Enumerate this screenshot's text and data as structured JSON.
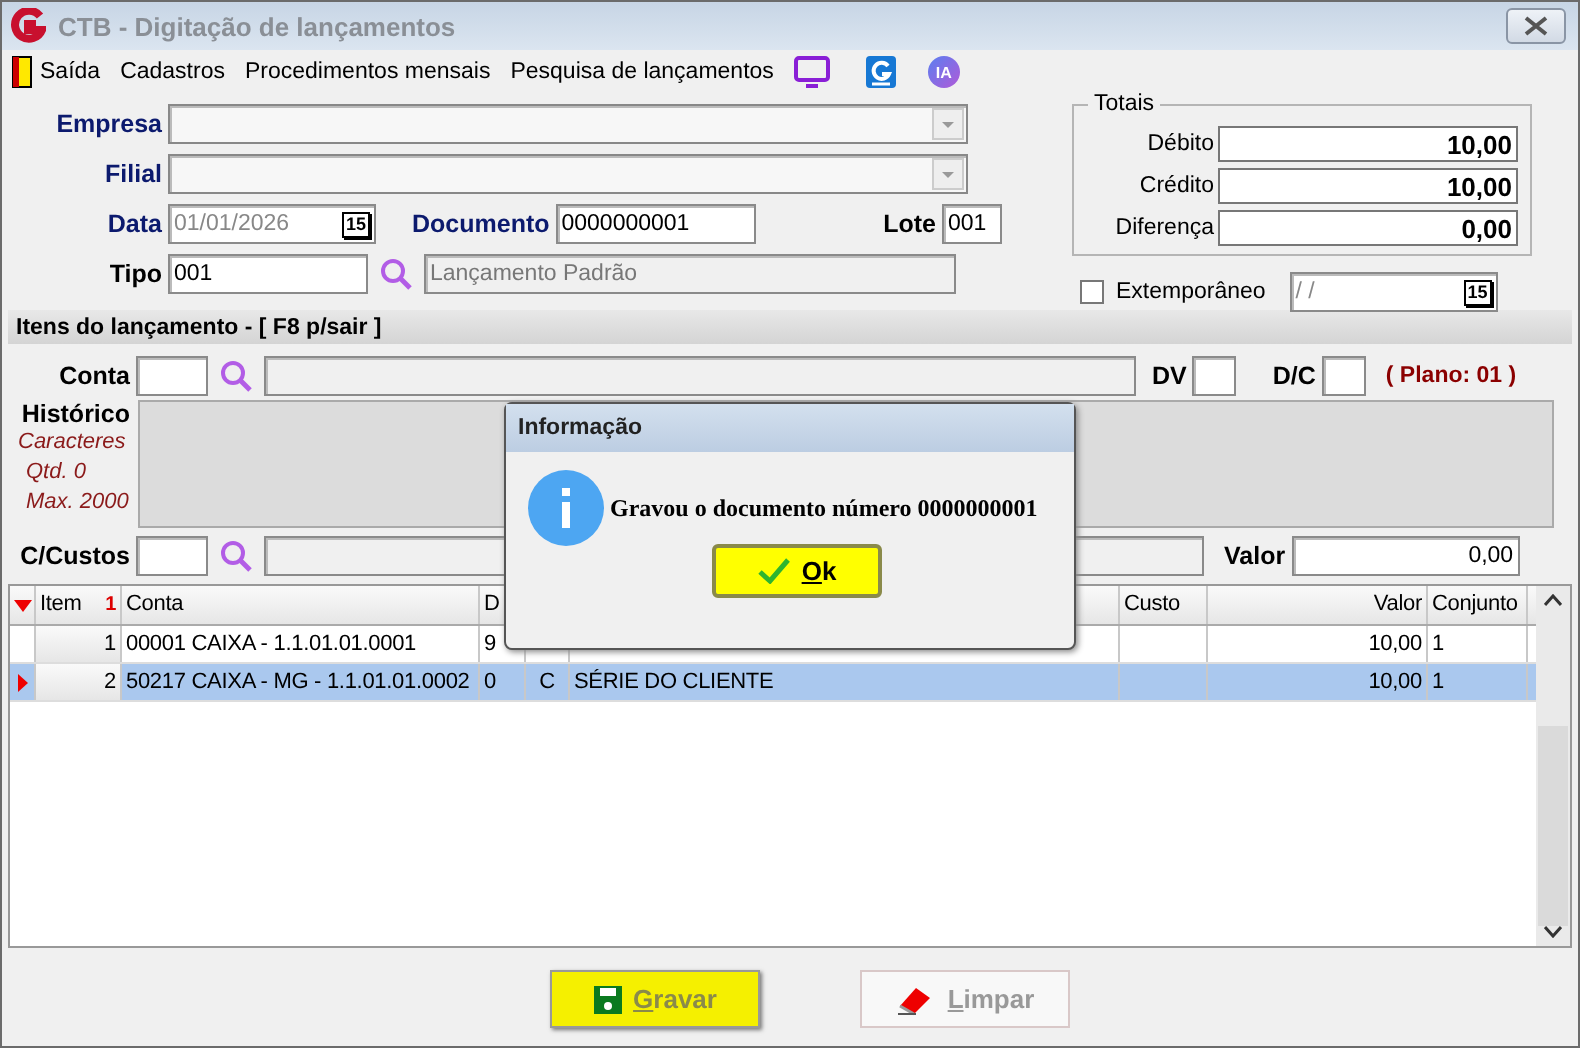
{
  "window": {
    "title": "CTB - Digitação de lançamentos"
  },
  "menu": {
    "items": [
      "Saída",
      "Cadastros",
      "Procedimentos mensais",
      "Pesquisa de lançamentos"
    ],
    "badge": "IA"
  },
  "header": {
    "empresa_label": "Empresa",
    "filial_label": "Filial",
    "data_label": "Data",
    "data_value": "01/01/2026",
    "calendar": "15",
    "documento_label": "Documento",
    "documento_value": "0000000001",
    "lote_label": "Lote",
    "lote_value": "001",
    "tipo_label": "Tipo",
    "tipo_value": "001",
    "tipo_description": "Lançamento Padrão"
  },
  "totais": {
    "title": "Totais",
    "rows": [
      {
        "label": "Débito",
        "value": "10,00"
      },
      {
        "label": "Crédito",
        "value": "10,00"
      },
      {
        "label": "Diferença",
        "value": "0,00"
      }
    ],
    "extemporaneo": {
      "label": "Extemporâneo",
      "checked": false,
      "date_value": "/ /",
      "calendar": "15"
    }
  },
  "items_section": {
    "title": "Itens do lançamento - [ F8 p/sair ]",
    "conta_label": "Conta",
    "dv_label": "DV",
    "dc_label": "D/C",
    "plano": "( Plano: 01 )",
    "historico_label": "Histórico",
    "historico_notes": [
      "Caracteres",
      "Qtd. 0",
      "Max. 2000"
    ],
    "ccustos_label": "C/Custos",
    "valor_label": "Valor",
    "valor_value": "0,00"
  },
  "grid": {
    "sort_mark": "1",
    "columns": [
      "Item",
      "Conta",
      "D",
      "",
      "",
      "Custo",
      "Valor",
      "Conjunto"
    ],
    "rows": [
      {
        "selected": false,
        "cells": [
          "1",
          "00001 CAIXA - 1.1.01.01.0001",
          "9",
          "",
          "",
          "",
          "10,00",
          "1"
        ]
      },
      {
        "selected": true,
        "cells": [
          "2",
          "50217 CAIXA - MG - 1.1.01.01.0002",
          "0",
          "C",
          "SÉRIE  DO CLIENTE",
          "",
          "10,00",
          "1"
        ]
      }
    ]
  },
  "dialog": {
    "title": "Informação",
    "message": "Gravou o documento número 0000000001",
    "ok": "Ok"
  },
  "buttons": [
    {
      "label": "Gravar",
      "kind": "save"
    },
    {
      "label": "Limpar",
      "kind": "clear"
    }
  ]
}
